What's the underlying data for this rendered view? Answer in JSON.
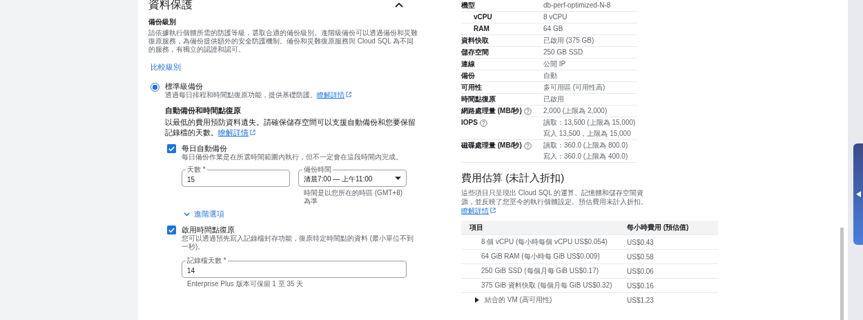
{
  "left": {
    "section_title": "資料保護",
    "expanded": true,
    "backup_level": {
      "title": "備份級別",
      "description": "請依據執行個體所需的防護等級，選取合適的備份級別。進階級備份可以透過備份和災難復原服務，為備份提供額外的安全防護機制。備份和災難復原服務與 Cloud SQL 為不同的服務，有獨立的認證和認可。"
    },
    "compare_link": "比較級別",
    "tiers": [
      {
        "label": "標準級備份",
        "description": "透過每日排程和時間點復原功能，提供基礎防護。",
        "link": "瞭解詳情",
        "selected": true
      }
    ],
    "auto": {
      "title": "自動備份和時間點復原",
      "description": "以最低的費用預防資料遺失。請確保儲存空間可以支援自動備份和您要保留記錄檔的天數。",
      "link": "瞭解詳情"
    },
    "daily": {
      "label": "每日自動備份",
      "description": "每日備份作業是在所選時間範圍內執行，但不一定會在這段時間內完成。",
      "checked": true
    },
    "days_field": {
      "label": "天數 *",
      "value": "15"
    },
    "time_field": {
      "label": "備份時間",
      "value": "清晨7:00 — 上午11:00",
      "helper": "時間是以您所在的時區 (GMT+8) 為準"
    },
    "advanced": {
      "label": "進階選項",
      "expanded": false
    },
    "pitr": {
      "label": "啟用時間點復原",
      "description": "您可以透過預先寫入記錄檔封存功能，復原特定時間點的資料 (最小單位不到一秒)。",
      "checked": true
    },
    "log_field": {
      "label": "記錄檔天數 *",
      "value": "14",
      "helper": "Enterprise Plus 版本可保留 1 至 35 天"
    }
  },
  "specs": [
    {
      "label": "機型",
      "indent": false,
      "help": false,
      "values": [
        "db-perf-optimized-N-8"
      ]
    },
    {
      "label": "vCPU",
      "indent": true,
      "help": false,
      "values": [
        "8 vCPU"
      ]
    },
    {
      "label": "RAM",
      "indent": true,
      "help": false,
      "values": [
        "64 GB"
      ]
    },
    {
      "label": "資料快取",
      "indent": false,
      "help": false,
      "values": [
        "已啟用 (375 GB)"
      ]
    },
    {
      "label": "儲存空間",
      "indent": false,
      "help": false,
      "values": [
        "250 GB SSD"
      ]
    },
    {
      "label": "連線",
      "indent": false,
      "help": false,
      "values": [
        "公開 IP"
      ]
    },
    {
      "label": "備份",
      "indent": false,
      "help": false,
      "values": [
        "自動"
      ]
    },
    {
      "label": "可用性",
      "indent": false,
      "help": false,
      "values": [
        "多可用區 (可用性高)"
      ]
    },
    {
      "label": "時間點復原",
      "indent": false,
      "help": false,
      "values": [
        "已啟用"
      ]
    },
    {
      "label": "網路處理量 (MB/秒)",
      "indent": false,
      "help": true,
      "values": [
        "2,000 (上限為 2,000)"
      ]
    },
    {
      "label": "IOPS",
      "indent": false,
      "help": true,
      "values": [
        "讀取：13,500 (上限為 15,000)",
        "寫入 13,500，上限為 15,000"
      ]
    },
    {
      "label": "磁碟處理量 (MB/秒)",
      "indent": false,
      "help": true,
      "values": [
        "讀取：360.0 (上限為 800.0)",
        "寫入：360.0 (上限為 400.0)"
      ]
    }
  ],
  "cost": {
    "title": "費用估算 (未計入折扣)",
    "description": "這些項目只呈現出 Cloud SQL 的運算、記憶體和儲存空間資源，並反映了您至今的執行個體設定。預估費用未計入折扣。",
    "link": "瞭解詳情",
    "columns": [
      "項目",
      "每小時費用 (預估值)"
    ],
    "rows": [
      {
        "kind": "item",
        "item": "8 個 vCPU (每小時每個 vCPU US$0.054)",
        "price": "US$0.43"
      },
      {
        "kind": "item",
        "item": "64 GiB RAM (每小時每 GiB US$0.009)",
        "price": "US$0.58"
      },
      {
        "kind": "item",
        "item": "250 GiB SSD (每個月每 GiB US$0.17)",
        "price": "US$0.06"
      },
      {
        "kind": "item",
        "item": "375 GiB 資料快取 (每個月每 GiB US$0.32)",
        "price": "US$0.16"
      },
      {
        "kind": "group",
        "item": "結合的 VM (高可用性)",
        "price": "US$1.23",
        "expanded": false
      }
    ]
  }
}
